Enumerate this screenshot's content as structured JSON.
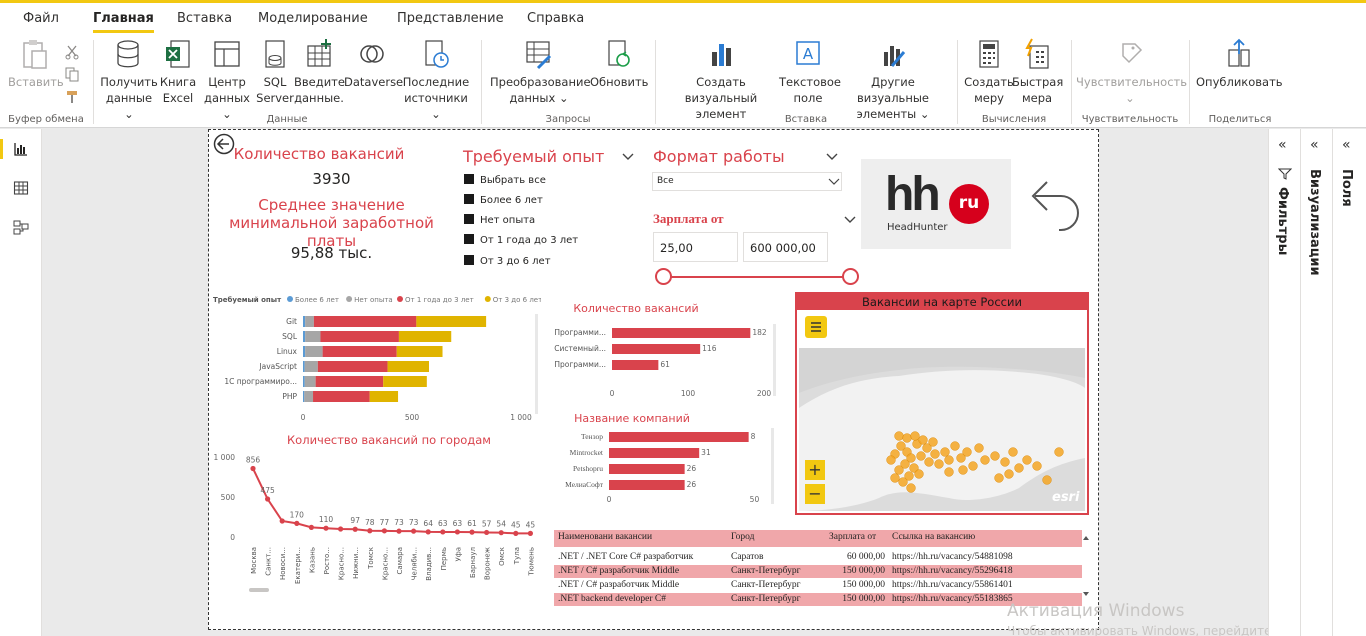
{
  "ribbon": {
    "tabs": [
      "Файл",
      "Главная",
      "Вставка",
      "Моделирование",
      "Представление",
      "Справка"
    ],
    "active_tab": "Главная",
    "buttons": {
      "paste": "Вставить",
      "get_data": [
        "Получить",
        "данные ⌄"
      ],
      "excel": [
        "Книга",
        "Excel"
      ],
      "data_hub": [
        "Центр",
        "данных ⌄"
      ],
      "sql": [
        "SQL",
        "Server"
      ],
      "enter_data": [
        "Введите",
        "данные."
      ],
      "dataverse": "Dataverse",
      "recent": [
        "Последние",
        "источники ⌄"
      ],
      "transform": [
        "Преобразование",
        "данных ⌄"
      ],
      "refresh": "Обновить",
      "new_visual": [
        "Создать визуальный",
        "элемент"
      ],
      "text_box": [
        "Текстовое",
        "поле"
      ],
      "more_visuals": [
        "Другие визуальные",
        "элементы ⌄"
      ],
      "new_measure": [
        "Создать",
        "меру"
      ],
      "quick_measure": [
        "Быстрая",
        "мера"
      ],
      "sensitivity": "Чувствительность",
      "sensitivity_caret": "⌄",
      "publish": "Опубликовать"
    },
    "groups": [
      "Буфер обмена",
      "Данные",
      "Запросы",
      "Вставка",
      "Вычисления",
      "Чувствительность",
      "Поделиться"
    ]
  },
  "panes": {
    "filters": "Фильтры",
    "visualizations": "Визуализации",
    "fields": "Поля"
  },
  "kpi": {
    "count_title": "Количество вакансий",
    "count_value": "3930",
    "salary_title_1": "Среднее значение",
    "salary_title_2": "минимальной заработной платы",
    "salary_value": "95,88 тыс."
  },
  "experience_slicer": {
    "title": "Требуемый опыт",
    "items": [
      "Выбрать все",
      "Более 6 лет",
      "Нет опыта",
      "От 1 года до 3 лет",
      "От 3 до 6 лет"
    ]
  },
  "work_format": {
    "title": "Формат работы",
    "selected": "Все"
  },
  "salary_slicer": {
    "title": "Зарплата от",
    "min": "25,00",
    "max": "600 000,00"
  },
  "logo": {
    "text": "hh",
    "badge": "ru",
    "sub": "HeadHunter"
  },
  "map": {
    "title": "Вакансии на карте России",
    "brand": "esri",
    "zoom_in": "+",
    "zoom_out": "−"
  },
  "watermark": {
    "line1": "Активация Windows",
    "line2": "Чтобы активировать Windows, перейдите в"
  },
  "colors": {
    "accent": "#d9434c",
    "series": [
      "#5b9bd5",
      "#a6a6a6",
      "#d9434c",
      "#e0b400"
    ]
  },
  "chart_data": [
    {
      "type": "bar",
      "orientation": "horizontal-stacked",
      "legend_title": "Требуемый опыт",
      "legend_position": "top",
      "categories": [
        "Git",
        "SQL",
        "Linux",
        "JavaScript",
        "1С программиро...",
        "PHP"
      ],
      "series": [
        {
          "name": "Более 6 лет",
          "values": [
            10,
            10,
            10,
            8,
            8,
            6
          ]
        },
        {
          "name": "Нет опыта",
          "values": [
            40,
            70,
            80,
            60,
            50,
            40
          ]
        },
        {
          "name": "От 1 года до 3 лет",
          "values": [
            470,
            360,
            340,
            320,
            310,
            260
          ]
        },
        {
          "name": "От 3 до 6 лет",
          "values": [
            320,
            240,
            210,
            190,
            200,
            130
          ]
        }
      ],
      "xticks": [
        "0",
        "500",
        "1 000"
      ],
      "xlim": [
        0,
        1000
      ]
    },
    {
      "type": "line",
      "title": "Количество вакансий по городам",
      "categories": [
        "Москва",
        "Санкт...",
        "Новоси...",
        "Екатери...",
        "Казань",
        "Росто...",
        "Красно...",
        "Нижни...",
        "Томск",
        "Красно...",
        "Самара",
        "Челяби...",
        "Владив...",
        "Пермь",
        "Уфа",
        "Барнаул",
        "Воронеж",
        "Омск",
        "Тула",
        "Тюмень"
      ],
      "values": [
        856,
        475,
        200,
        170,
        120,
        110,
        100,
        97,
        78,
        77,
        73,
        73,
        64,
        63,
        63,
        61,
        57,
        54,
        45,
        45
      ],
      "labels": [
        "856",
        "475",
        "",
        "170",
        "",
        "110",
        "",
        "97",
        "78",
        "77",
        "73",
        "73",
        "64",
        "63",
        "63",
        "61",
        "57",
        "54",
        "45",
        "45"
      ],
      "yticks": [
        "1 000",
        "500",
        "0"
      ],
      "ylim": [
        0,
        1000
      ]
    },
    {
      "type": "bar",
      "orientation": "horizontal",
      "title": "Количество вакансий",
      "categories": [
        "Программи...",
        "Системный...",
        "Программи..."
      ],
      "values": [
        182,
        116,
        61
      ],
      "xticks": [
        "0",
        "100",
        "200"
      ],
      "xlim": [
        0,
        200
      ]
    },
    {
      "type": "bar",
      "orientation": "horizontal",
      "title": "Название компаний",
      "categories": [
        "Тензор",
        "Mintrocket",
        "Petshopru",
        "МелиаСофт"
      ],
      "values": [
        48,
        31,
        26,
        26
      ],
      "labels": [
        "8",
        "31",
        "26",
        "26"
      ],
      "xticks": [
        "0",
        "50"
      ],
      "xlim": [
        0,
        55
      ]
    },
    {
      "type": "table",
      "columns": [
        "Наименовани вакансии",
        "Город",
        "Зарплата от",
        "Ссылка на вакансию"
      ],
      "rows": [
        [
          ".NET / .NET Core C# разработчик",
          "Саратов",
          "60 000,00",
          "https://hh.ru/vacancy/54881098"
        ],
        [
          ".NET / C# разработчик Middle",
          "Санкт-Петербург",
          "150 000,00",
          "https://hh.ru/vacancy/55296418"
        ],
        [
          ".NET / C# разработчик Middle",
          "Санкт-Петербург",
          "150 000,00",
          "https://hh.ru/vacancy/55861401"
        ],
        [
          ".NET backend developer C#",
          "Санкт-Петербург",
          "150 000,00",
          "https://hh.ru/vacancy/55183865"
        ]
      ]
    }
  ]
}
